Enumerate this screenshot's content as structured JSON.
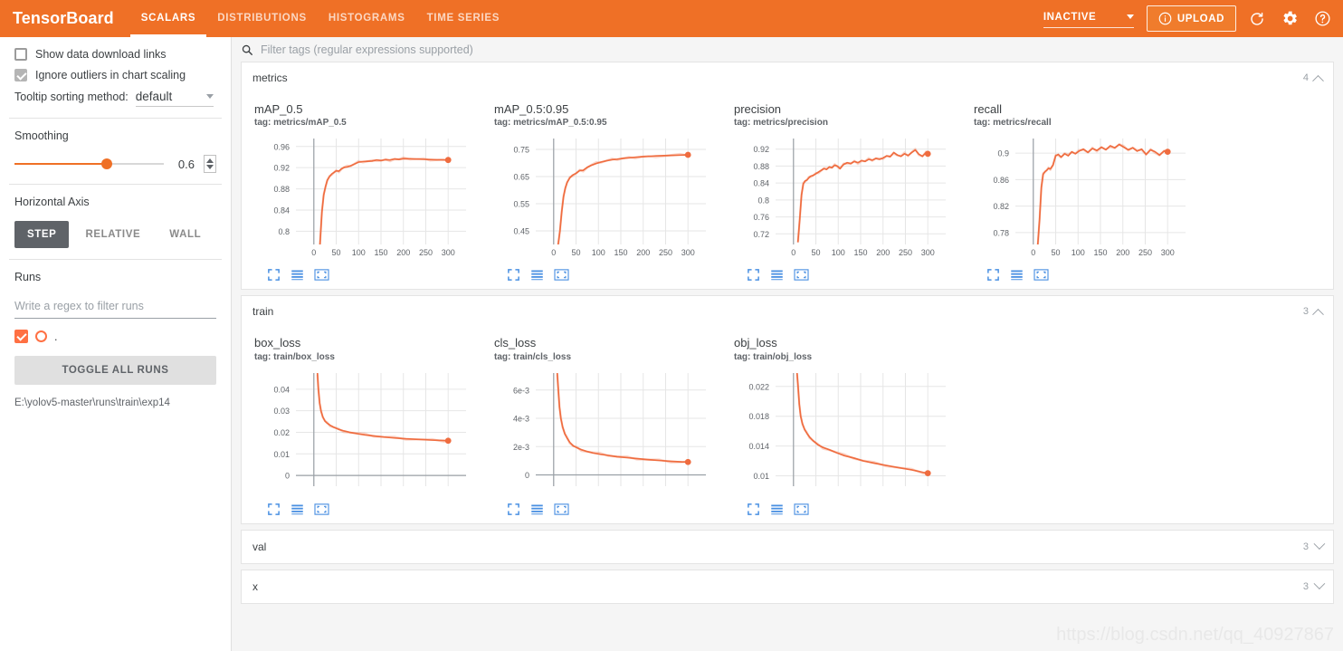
{
  "app": {
    "brand": "TensorBoard",
    "accent": "#ef7026",
    "series_color": "#ef6c3f"
  },
  "header": {
    "tabs": [
      {
        "label": "SCALARS",
        "active": true
      },
      {
        "label": "DISTRIBUTIONS",
        "active": false
      },
      {
        "label": "HISTOGRAMS",
        "active": false
      },
      {
        "label": "TIME SERIES",
        "active": false
      }
    ],
    "run_state": "INACTIVE",
    "upload_label": "UPLOAD",
    "icons": [
      "info-icon",
      "refresh-icon",
      "gear-icon",
      "help-icon"
    ]
  },
  "sidebar": {
    "show_download_links": "Show data download links",
    "ignore_outliers": "Ignore outliers in chart scaling",
    "tooltip_label": "Tooltip sorting method:",
    "tooltip_value": "default",
    "smoothing_label": "Smoothing",
    "smoothing_value": "0.6",
    "horizontal_axis_label": "Horizontal Axis",
    "axis_options": [
      {
        "label": "STEP",
        "active": true
      },
      {
        "label": "RELATIVE",
        "active": false
      },
      {
        "label": "WALL",
        "active": false
      }
    ],
    "runs_label": "Runs",
    "runs_placeholder": "Write a regex to filter runs",
    "run_name": ".",
    "toggle_all_label": "TOGGLE ALL RUNS",
    "run_path": "E:\\yolov5-master\\runs\\train\\exp14"
  },
  "filter": {
    "placeholder": "Filter tags (regular expressions supported)",
    "value": ""
  },
  "sections": [
    {
      "name": "metrics",
      "count": "4",
      "expanded": true
    },
    {
      "name": "train",
      "count": "3",
      "expanded": true
    },
    {
      "name": "val",
      "count": "3",
      "expanded": false
    },
    {
      "name": "x",
      "count": "3",
      "expanded": false
    }
  ],
  "chart_tools": [
    "fit-domain-icon",
    "data-table-icon",
    "fullscreen-icon"
  ],
  "watermark": "https://blog.csdn.net/qq_40927867",
  "chart_data": [
    {
      "type": "line",
      "title": "mAP_0.5",
      "tag": "tag: metrics/mAP_0.5",
      "xlabel": "",
      "ylabel": "",
      "xlim": [
        -40,
        340
      ],
      "ylim": [
        0.775,
        0.975
      ],
      "xticks": [
        0,
        50,
        100,
        150,
        200,
        250,
        300
      ],
      "yticks": [
        0.8,
        0.84,
        0.88,
        0.92,
        0.96
      ],
      "ytick_labels": [
        "0.8",
        "0.84",
        "0.88",
        "0.92",
        "0.96"
      ],
      "grid": true,
      "series": [
        {
          "name": ".",
          "x": [
            10,
            14,
            18,
            22,
            26,
            30,
            35,
            40,
            45,
            50,
            56,
            62,
            68,
            75,
            82,
            90,
            100,
            110,
            120,
            130,
            140,
            150,
            160,
            170,
            180,
            190,
            200,
            215,
            230,
            245,
            260,
            275,
            290,
            300
          ],
          "y": [
            0.72,
            0.78,
            0.836,
            0.868,
            0.884,
            0.896,
            0.903,
            0.908,
            0.911,
            0.914,
            0.9135,
            0.918,
            0.9205,
            0.9215,
            0.9235,
            0.9265,
            0.9305,
            0.9315,
            0.932,
            0.9325,
            0.9345,
            0.9335,
            0.935,
            0.9345,
            0.9365,
            0.9355,
            0.937,
            0.9368,
            0.9362,
            0.9358,
            0.9352,
            0.9348,
            0.9345,
            0.9345
          ]
        }
      ],
      "final_marker": {
        "x": 300,
        "y": 0.9345
      }
    },
    {
      "type": "line",
      "title": "mAP_0.5:0.95",
      "tag": "tag: metrics/mAP_0.5:0.95",
      "xlabel": "",
      "ylabel": "",
      "xlim": [
        -40,
        340
      ],
      "ylim": [
        0.4,
        0.79
      ],
      "xticks": [
        0,
        50,
        100,
        150,
        200,
        250,
        300
      ],
      "yticks": [
        0.45,
        0.55,
        0.65,
        0.75
      ],
      "ytick_labels": [
        "0.45",
        "0.55",
        "0.65",
        "0.75"
      ],
      "grid": true,
      "series": [
        {
          "name": ".",
          "x": [
            10,
            14,
            18,
            22,
            26,
            30,
            36,
            42,
            50,
            58,
            66,
            75,
            85,
            95,
            105,
            118,
            130,
            142,
            155,
            168,
            182,
            196,
            210,
            228,
            246,
            264,
            282,
            300
          ],
          "y": [
            0.4,
            0.45,
            0.52,
            0.575,
            0.608,
            0.628,
            0.645,
            0.655,
            0.662,
            0.672,
            0.673,
            0.684,
            0.692,
            0.698,
            0.703,
            0.708,
            0.712,
            0.714,
            0.717,
            0.719,
            0.721,
            0.723,
            0.724,
            0.726,
            0.727,
            0.728,
            0.729,
            0.73
          ]
        }
      ],
      "final_marker": {
        "x": 300,
        "y": 0.73
      }
    },
    {
      "type": "line",
      "title": "precision",
      "tag": "tag: metrics/precision",
      "xlabel": "",
      "ylabel": "",
      "xlim": [
        -40,
        340
      ],
      "ylim": [
        0.695,
        0.945
      ],
      "xticks": [
        0,
        50,
        100,
        150,
        200,
        250,
        300
      ],
      "yticks": [
        0.72,
        0.76,
        0.8,
        0.84,
        0.88,
        0.92
      ],
      "ytick_labels": [
        "0.72",
        "0.76",
        "0.8",
        "0.84",
        "0.88",
        "0.92"
      ],
      "grid": true,
      "series": [
        {
          "name": ".",
          "x": [
            10,
            14,
            18,
            22,
            26,
            30,
            34,
            38,
            44,
            50,
            56,
            62,
            68,
            74,
            80,
            86,
            92,
            98,
            104,
            112,
            120,
            128,
            136,
            144,
            152,
            160,
            168,
            176,
            184,
            192,
            200,
            208,
            216,
            224,
            232,
            240,
            248,
            256,
            264,
            272,
            280,
            288,
            296,
            300
          ],
          "y": [
            0.702,
            0.755,
            0.812,
            0.838,
            0.845,
            0.847,
            0.852,
            0.856,
            0.858,
            0.862,
            0.866,
            0.87,
            0.874,
            0.872,
            0.878,
            0.876,
            0.882,
            0.88,
            0.874,
            0.884,
            0.888,
            0.886,
            0.891,
            0.888,
            0.893,
            0.891,
            0.896,
            0.894,
            0.898,
            0.896,
            0.899,
            0.904,
            0.902,
            0.912,
            0.906,
            0.903,
            0.909,
            0.905,
            0.912,
            0.918,
            0.908,
            0.903,
            0.912,
            0.909
          ]
        }
      ],
      "final_marker": {
        "x": 300,
        "y": 0.909
      }
    },
    {
      "type": "line",
      "title": "recall",
      "tag": "tag: metrics/recall",
      "xlabel": "",
      "ylabel": "",
      "xlim": [
        -40,
        340
      ],
      "ylim": [
        0.762,
        0.922
      ],
      "xticks": [
        0,
        50,
        100,
        150,
        200,
        250,
        300
      ],
      "yticks": [
        0.78,
        0.82,
        0.86,
        0.9
      ],
      "ytick_labels": [
        "0.78",
        "0.82",
        "0.86",
        "0.9"
      ],
      "grid": true,
      "series": [
        {
          "name": ".",
          "x": [
            10,
            14,
            18,
            22,
            26,
            30,
            34,
            38,
            44,
            50,
            56,
            62,
            70,
            78,
            86,
            94,
            102,
            112,
            122,
            132,
            142,
            152,
            162,
            172,
            182,
            192,
            202,
            212,
            222,
            232,
            242,
            252,
            262,
            272,
            282,
            292,
            300
          ],
          "y": [
            0.762,
            0.8,
            0.848,
            0.868,
            0.872,
            0.874,
            0.877,
            0.876,
            0.882,
            0.896,
            0.898,
            0.894,
            0.899,
            0.896,
            0.902,
            0.899,
            0.903,
            0.906,
            0.901,
            0.907,
            0.904,
            0.909,
            0.905,
            0.911,
            0.908,
            0.913,
            0.909,
            0.905,
            0.908,
            0.903,
            0.906,
            0.898,
            0.905,
            0.902,
            0.897,
            0.903,
            0.902
          ]
        }
      ],
      "final_marker": {
        "x": 300,
        "y": 0.902
      }
    },
    {
      "type": "line",
      "title": "box_loss",
      "tag": "tag: train/box_loss",
      "xlabel": "",
      "ylabel": "",
      "xlim": [
        -40,
        340
      ],
      "ylim": [
        -0.005,
        0.0475
      ],
      "xticks": [],
      "yticks": [
        0,
        0.01,
        0.02,
        0.03,
        0.04
      ],
      "ytick_labels": [
        "0",
        "0.01",
        "0.02",
        "0.03",
        "0.04"
      ],
      "grid": true,
      "series": [
        {
          "name": ".",
          "x": [
            8,
            10,
            13,
            16,
            20,
            25,
            30,
            36,
            44,
            54,
            66,
            80,
            96,
            114,
            134,
            156,
            180,
            206,
            234,
            264,
            290,
            300
          ],
          "y": [
            0.0475,
            0.0405,
            0.0335,
            0.0298,
            0.0272,
            0.0252,
            0.0242,
            0.0233,
            0.0224,
            0.0215,
            0.0207,
            0.02,
            0.0194,
            0.0188,
            0.0183,
            0.0178,
            0.0174,
            0.017,
            0.0167,
            0.0164,
            0.0162,
            0.0161
          ]
        }
      ],
      "final_marker": {
        "x": 300,
        "y": 0.0161
      }
    },
    {
      "type": "line",
      "title": "cls_loss",
      "tag": "tag: train/cls_loss",
      "xlabel": "",
      "ylabel": "",
      "xlim": [
        -40,
        340
      ],
      "ylim": [
        -0.0008,
        0.0072
      ],
      "xticks": [],
      "yticks": [
        0,
        0.002,
        0.004,
        0.006
      ],
      "ytick_labels": [
        "0",
        "2e-3",
        "4e-3",
        "6e-3"
      ],
      "grid": true,
      "series": [
        {
          "name": ".",
          "x": [
            8,
            10,
            13,
            16,
            20,
            25,
            30,
            36,
            44,
            52,
            62,
            74,
            88,
            104,
            122,
            142,
            164,
            186,
            210,
            236,
            262,
            286,
            300
          ],
          "y": [
            0.0072,
            0.0062,
            0.0048,
            0.004,
            0.0034,
            0.0029,
            0.0026,
            0.0023,
            0.00205,
            0.00192,
            0.00178,
            0.00166,
            0.00155,
            0.00146,
            0.00138,
            0.00128,
            0.00122,
            0.00115,
            0.00108,
            0.00102,
            0.00096,
            0.00092,
            0.00091
          ]
        }
      ],
      "final_marker": {
        "x": 300,
        "y": 0.00091
      }
    },
    {
      "type": "line",
      "title": "obj_loss",
      "tag": "tag: train/obj_loss",
      "xlabel": "",
      "ylabel": "",
      "xlim": [
        -40,
        340
      ],
      "ylim": [
        0.0086,
        0.0238
      ],
      "xticks": [],
      "yticks": [
        0.01,
        0.014,
        0.018,
        0.022
      ],
      "ytick_labels": [
        "0.01",
        "0.014",
        "0.018",
        "0.022"
      ],
      "grid": true,
      "series": [
        {
          "name": ".",
          "x": [
            8,
            10,
            13,
            16,
            20,
            25,
            30,
            36,
            44,
            54,
            66,
            80,
            96,
            114,
            134,
            156,
            180,
            206,
            234,
            264,
            290,
            300
          ],
          "y": [
            0.0238,
            0.0222,
            0.0196,
            0.018,
            0.017,
            0.0162,
            0.0157,
            0.0152,
            0.0147,
            0.0142,
            0.0138,
            0.0135,
            0.0131,
            0.0127,
            0.0124,
            0.012,
            0.0117,
            0.0114,
            0.0111,
            0.0108,
            0.01045,
            0.01035
          ]
        }
      ],
      "final_marker": {
        "x": 300,
        "y": 0.01035
      }
    }
  ]
}
